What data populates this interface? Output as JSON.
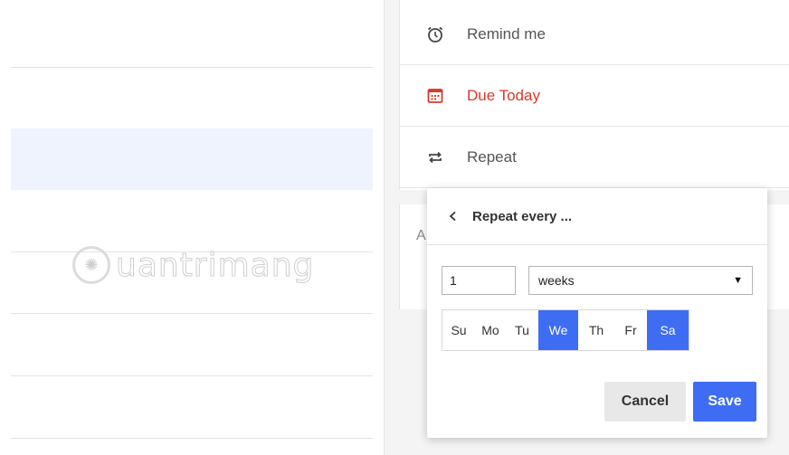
{
  "detail": {
    "remind_label": "Remind me",
    "due_label": "Due Today",
    "repeat_label": "Repeat",
    "notes_letter": "A"
  },
  "popup": {
    "title": "Repeat every ...",
    "interval_value": "1",
    "unit_selected": "weeks",
    "days": [
      {
        "label": "Su",
        "active": false
      },
      {
        "label": "Mo",
        "active": false
      },
      {
        "label": "Tu",
        "active": false
      },
      {
        "label": "We",
        "active": true
      },
      {
        "label": "Th",
        "active": false
      },
      {
        "label": "Fr",
        "active": false
      },
      {
        "label": "Sa",
        "active": true
      }
    ],
    "cancel_label": "Cancel",
    "save_label": "Save"
  },
  "watermark": {
    "text": "uantrimang",
    "initial": "Q"
  },
  "colors": {
    "accent": "#3e6df3",
    "due_red": "#d9392b",
    "selected_row": "#eef3fd"
  }
}
